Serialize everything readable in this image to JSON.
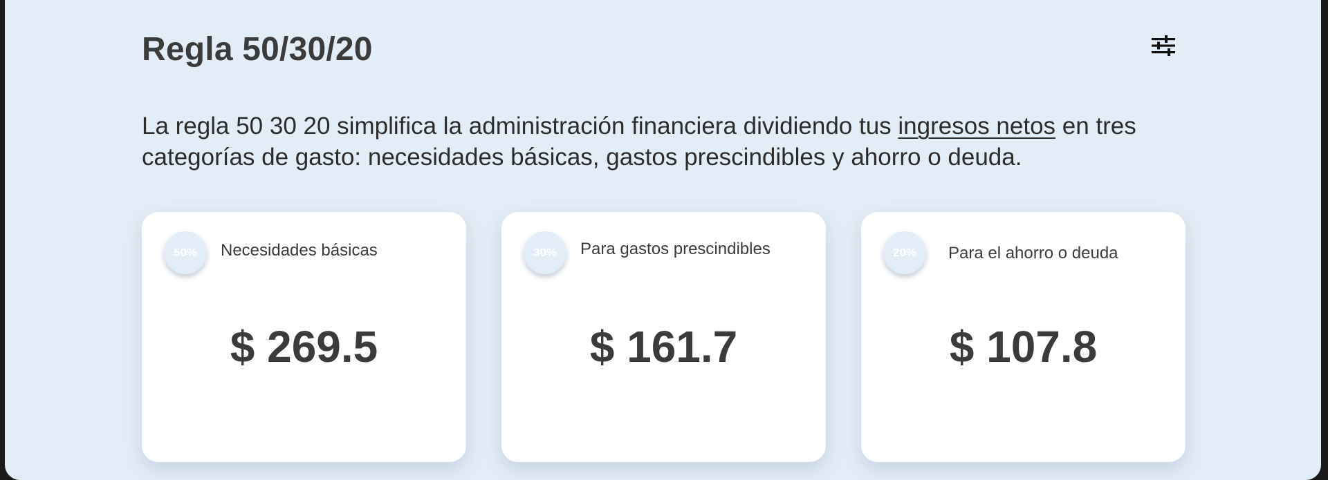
{
  "header": {
    "title": "Regla 50/30/20",
    "settings_icon": "sliders-icon"
  },
  "intro": {
    "text_before": "La regla 50 30 20 simplifica la administración financiera dividiendo tus ",
    "link_text": "ingresos netos",
    "text_after": " en tres categorías de gasto: necesidades básicas, gastos prescindibles y ahorro o deuda."
  },
  "cards": [
    {
      "percent": "50%",
      "label": "Necesidades básicas",
      "amount": "$ 269.5"
    },
    {
      "percent": "30%",
      "label": "Para gastos prescindibles",
      "amount": "$ 161.7"
    },
    {
      "percent": "20%",
      "label": "Para el ahorro o deuda",
      "amount": "$ 107.8"
    }
  ],
  "colors": {
    "background": "#e3edf7",
    "card": "#ffffff",
    "text": "#3b3b3b",
    "badge_text": "#ffffff"
  }
}
